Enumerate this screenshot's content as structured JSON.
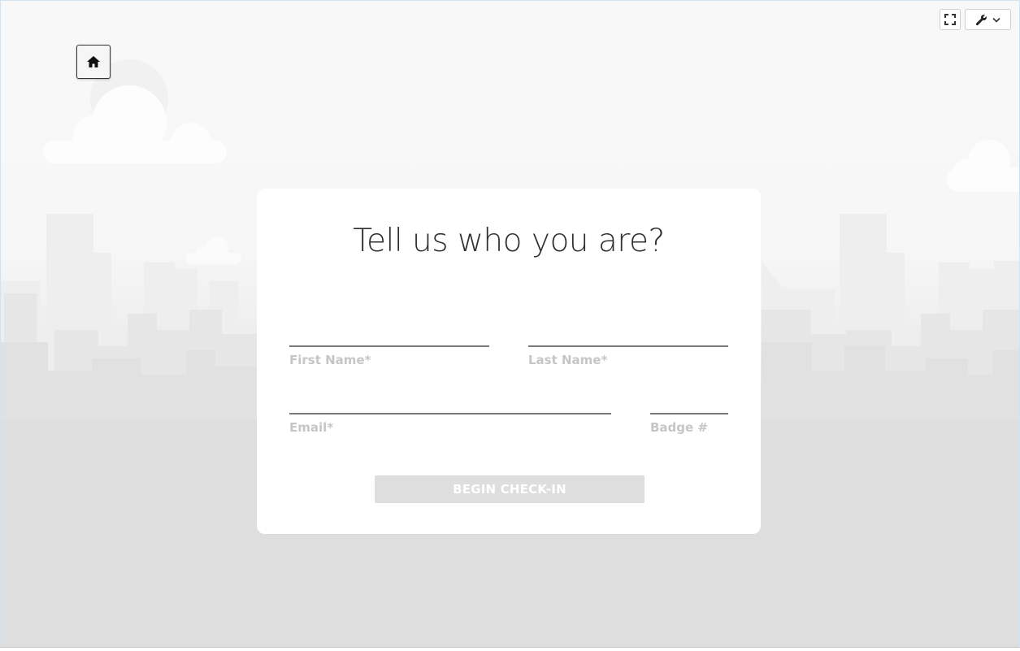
{
  "form": {
    "title": "Tell us who you are?",
    "first_name": {
      "label": "First Name*",
      "value": ""
    },
    "last_name": {
      "label": "Last Name*",
      "value": ""
    },
    "email": {
      "label": "Email*",
      "value": ""
    },
    "badge": {
      "label": "Badge #",
      "value": ""
    },
    "submit_label": "BEGIN CHECK-IN"
  },
  "toolbar": {
    "home_icon": "home-icon",
    "fullscreen_icon": "fullscreen-icon",
    "tools_icon": "wrench-icon",
    "tools_dropdown_icon": "chevron-down-icon"
  },
  "colors": {
    "background_top": "#f8f8f8",
    "background_bottom": "#dedede",
    "card": "#ffffff",
    "title_text": "#2f2f2f",
    "field_label": "#c6c6c6",
    "field_line": "#7a7a7a",
    "button_disabled": "#dedede"
  }
}
